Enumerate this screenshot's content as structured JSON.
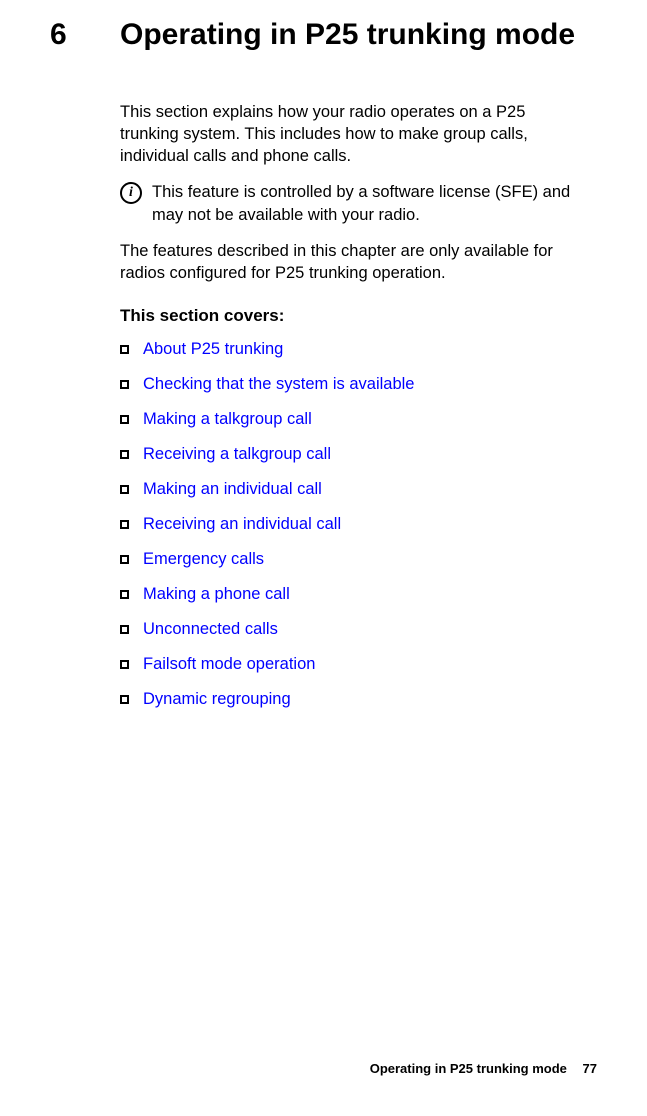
{
  "chapter": {
    "number": "6",
    "title": "Operating in P25 trunking mode"
  },
  "paragraphs": {
    "intro": "This section explains how your radio operates on a P25 trunking system. This includes how to make group calls, individual calls and phone calls.",
    "note": "This feature is controlled by a software license (SFE) and may not be available with your radio.",
    "features": "The features described in this chapter are only available for radios configured for P25 trunking operation."
  },
  "section_covers_label": "This section covers:",
  "toc": [
    "About P25 trunking",
    "Checking that the system is available",
    "Making a talkgroup call",
    "Receiving a talkgroup call",
    "Making an individual call",
    "Receiving an individual call",
    "Emergency calls",
    "Making a phone call",
    "Unconnected calls",
    "Failsoft mode operation",
    "Dynamic regrouping"
  ],
  "footer": {
    "title": "Operating in P25 trunking mode",
    "page": "77"
  }
}
